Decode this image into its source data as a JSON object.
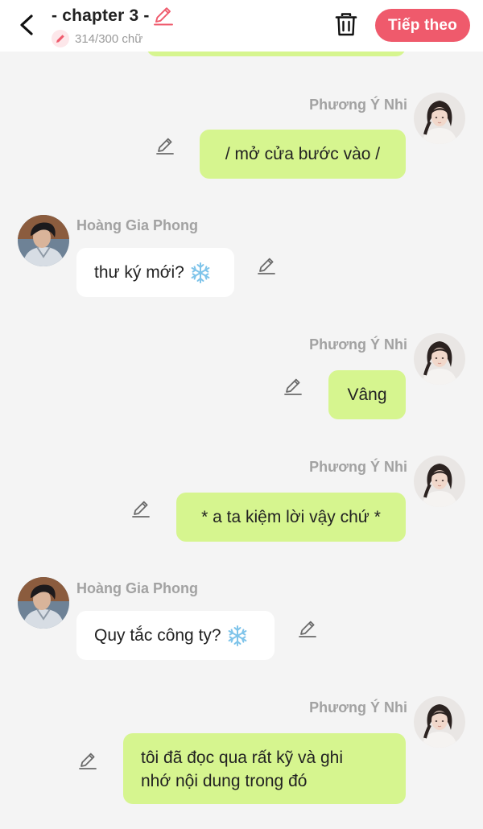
{
  "header": {
    "title": "- chapter 3 -",
    "word_count": "314/300 chữ",
    "next_label": "Tiếp theo",
    "accent_color": "#ef5a6c"
  },
  "messages": [
    {
      "sender": "Phương Ý Nhi",
      "side": "right",
      "text": "/ mở cửa bước vào /"
    },
    {
      "sender": "Hoàng Gia Phong",
      "side": "left",
      "text": "thư ký mới?",
      "emoji": "snowflake"
    },
    {
      "sender": "Phương Ý Nhi",
      "side": "right",
      "text": "Vâng"
    },
    {
      "sender": "Phương Ý Nhi",
      "side": "right",
      "text": "* a ta kiệm lời vậy chứ *"
    },
    {
      "sender": "Hoàng Gia Phong",
      "side": "left",
      "text": "Quy tắc công ty?",
      "emoji": "snowflake"
    },
    {
      "sender": "Phương Ý Nhi",
      "side": "right",
      "text_lines": [
        "tôi đã đọc qua rất kỹ và ghi",
        "nhớ nội dung trong đó"
      ]
    }
  ],
  "colors": {
    "my_bubble": "#d6f58f",
    "their_bubble": "#ffffff",
    "background": "#f4f4f4",
    "name_text": "#a2a2a2"
  }
}
